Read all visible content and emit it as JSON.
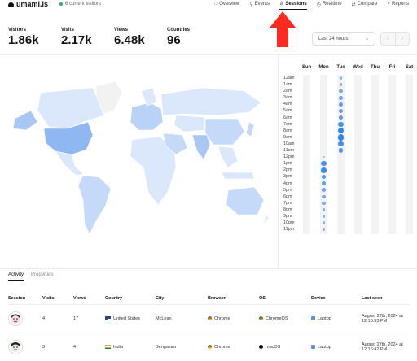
{
  "app": {
    "name": "umami.is",
    "current_visitors": "6 current visitors"
  },
  "nav": [
    {
      "label": "Overview",
      "icon": "overview-icon",
      "glyph": "□",
      "active": false
    },
    {
      "label": "Events",
      "icon": "events-icon",
      "glyph": "⚲",
      "active": false
    },
    {
      "label": "Sessions",
      "icon": "sessions-icon",
      "glyph": "♙",
      "active": true
    },
    {
      "label": "Realtime",
      "icon": "realtime-icon",
      "glyph": "◷",
      "active": false
    },
    {
      "label": "Compare",
      "icon": "compare-icon",
      "glyph": "⇄",
      "active": false
    },
    {
      "label": "Reports",
      "icon": "reports-icon",
      "glyph": "◔",
      "active": false
    }
  ],
  "metrics": [
    {
      "label": "Visitors",
      "value": "1.86k"
    },
    {
      "label": "Visits",
      "value": "2.17k"
    },
    {
      "label": "Views",
      "value": "6.48k"
    },
    {
      "label": "Countries",
      "value": "96"
    }
  ],
  "range": {
    "selected": "Last 24 hours"
  },
  "heatmap": {
    "days": [
      "Sun",
      "Mon",
      "Tue",
      "Wed",
      "Thu",
      "Fri",
      "Sat"
    ],
    "hours": [
      "12am",
      "1am",
      "2am",
      "3am",
      "4am",
      "5am",
      "6am",
      "7am",
      "8am",
      "9am",
      "10am",
      "11am",
      "12pm",
      "1pm",
      "2pm",
      "3pm",
      "4pm",
      "5pm",
      "6pm",
      "7pm",
      "8pm",
      "9pm",
      "10pm",
      "11pm"
    ],
    "tue_levels": [
      0.3,
      0.35,
      0.45,
      0.5,
      0.6,
      0.6,
      0.65,
      0.75,
      0.9,
      0.95,
      0.8,
      0.7,
      0,
      0,
      0,
      0,
      0,
      0,
      0,
      0,
      0,
      0,
      0,
      0
    ],
    "mon_levels": [
      0,
      0,
      0,
      0,
      0,
      0,
      0,
      0,
      0,
      0,
      0,
      0,
      0.05,
      0.75,
      0.85,
      0.7,
      0.6,
      0.5,
      0.45,
      0.4,
      0.35,
      0.3,
      0.3,
      0.3
    ]
  },
  "tabs": [
    {
      "label": "Activity",
      "active": true
    },
    {
      "label": "Properties",
      "active": false
    }
  ],
  "table": {
    "headers": [
      "Session",
      "Visits",
      "Views",
      "Country",
      "City",
      "Browser",
      "OS",
      "Device",
      "Last seen"
    ],
    "rows": [
      {
        "visits": "4",
        "views": "17",
        "country": "United States",
        "city": "McLean",
        "browser": "Chrome",
        "os": "ChromeOS",
        "device": "Laptop",
        "last_seen_date": "August 27th, 2024 at",
        "last_seen_time": "12:16:53 PM"
      },
      {
        "visits": "3",
        "views": "4",
        "country": "India",
        "city": "Bengaluru",
        "browser": "Chrome",
        "os": "macOS",
        "device": "Laptop",
        "last_seen_date": "August 27th, 2024 at",
        "last_seen_time": "12:16:42 PM"
      }
    ]
  },
  "colors": {
    "accent": "#2680eb",
    "map_land": "#dbe8fb",
    "map_active": "#8fb7f2",
    "arrow": "#ff2a1f"
  }
}
